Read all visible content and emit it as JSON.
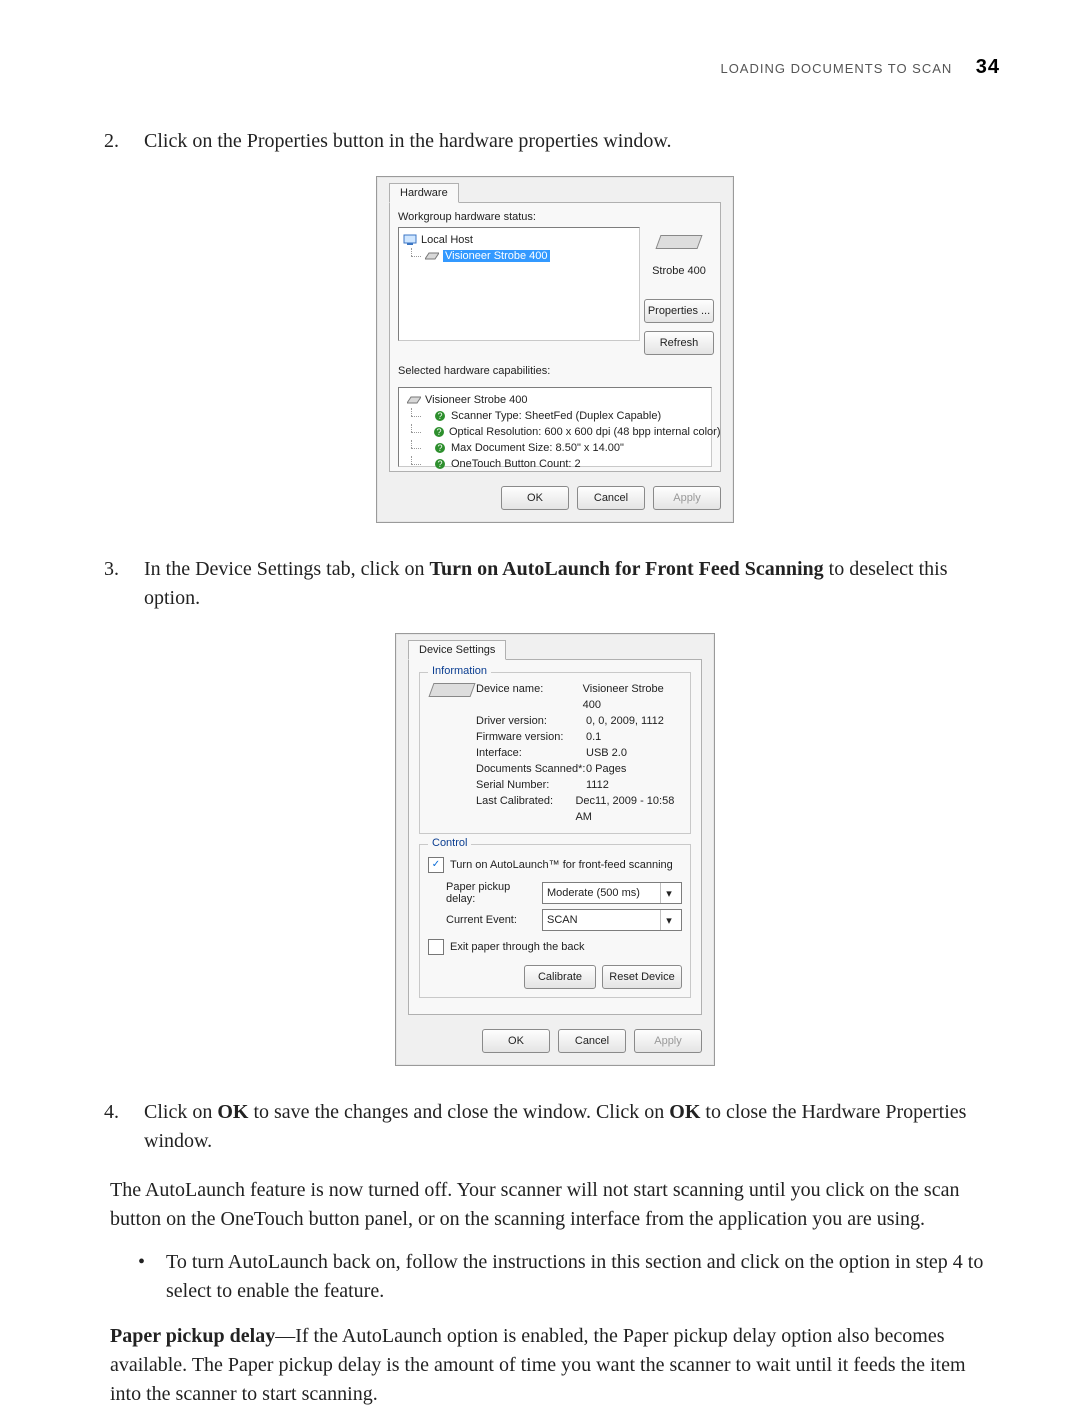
{
  "header": {
    "section": "LOADING DOCUMENTS TO SCAN",
    "page_number": "34"
  },
  "steps": {
    "s2": {
      "num": "2.",
      "text": "Click on the Properties button in the hardware properties window."
    },
    "s3": {
      "num": "3.",
      "prefix": "In the Device Settings tab, click on ",
      "bold": "Turn on AutoLaunch for Front Feed Scanning",
      "suffix": " to deselect this option."
    },
    "s4": {
      "num": "4.",
      "p1": "Click on ",
      "b1": "OK",
      "p2": " to save the changes and close the window. Click on ",
      "b2": "OK",
      "p3": " to close the Hardware Properties window."
    }
  },
  "prose": {
    "p1": "The AutoLaunch feature is now turned off. Your scanner will not start scanning until you click on the scan button on the OneTouch button panel, or on the scanning interface from the application you are using.",
    "bullet1": "To turn AutoLaunch back on, follow the instructions in this section and click on the option in step 4 to select to enable the feature.",
    "p2_b": "Paper pickup delay",
    "p2_rest": "—If the AutoLaunch option is enabled, the Paper pickup delay option also becomes available. The Paper pickup delay is the amount of time you want the scanner to wait until it feeds the item into the scanner to start scanning."
  },
  "dialog1": {
    "tab": "Hardware",
    "status_label": "Workgroup hardware status:",
    "tree_root": "Local Host",
    "tree_child": "Visioneer Strobe 400",
    "thumb_caption": "Strobe 400",
    "btn_properties": "Properties ...",
    "btn_refresh": "Refresh",
    "caps_label": "Selected hardware capabilities:",
    "caps_root": "Visioneer Strobe 400",
    "caps": [
      "Scanner Type: SheetFed (Duplex Capable)",
      "Optical Resolution: 600 x 600 dpi (48 bpp internal color)",
      "Max Document Size:  8.50\" x 14.00\"",
      "OneTouch Button Count: 2"
    ],
    "ok": "OK",
    "cancel": "Cancel",
    "apply": "Apply"
  },
  "dialog2": {
    "tab": "Device Settings",
    "grp_info": "Information",
    "info": [
      {
        "k": "Device name:",
        "v": "Visioneer Strobe 400"
      },
      {
        "k": "Driver version:",
        "v": "0, 0, 2009, 1112"
      },
      {
        "k": "Firmware version:",
        "v": "0.1"
      },
      {
        "k": "Interface:",
        "v": "USB 2.0"
      },
      {
        "k": "Documents Scanned*:",
        "v": "0 Pages"
      },
      {
        "k": "Serial Number:",
        "v": "1112"
      },
      {
        "k": "Last Calibrated:",
        "v": "Dec11, 2009 - 10:58 AM"
      }
    ],
    "grp_ctrl": "Control",
    "chk_autolaunch": "Turn on AutoLaunch™ for front-feed scanning",
    "lbl_delay": "Paper pickup delay:",
    "val_delay": "Moderate (500 ms)",
    "lbl_event": "Current Event:",
    "val_event": "SCAN",
    "chk_exit": "Exit paper through the back",
    "btn_cal": "Calibrate",
    "btn_reset": "Reset Device",
    "ok": "OK",
    "cancel": "Cancel",
    "apply": "Apply"
  }
}
